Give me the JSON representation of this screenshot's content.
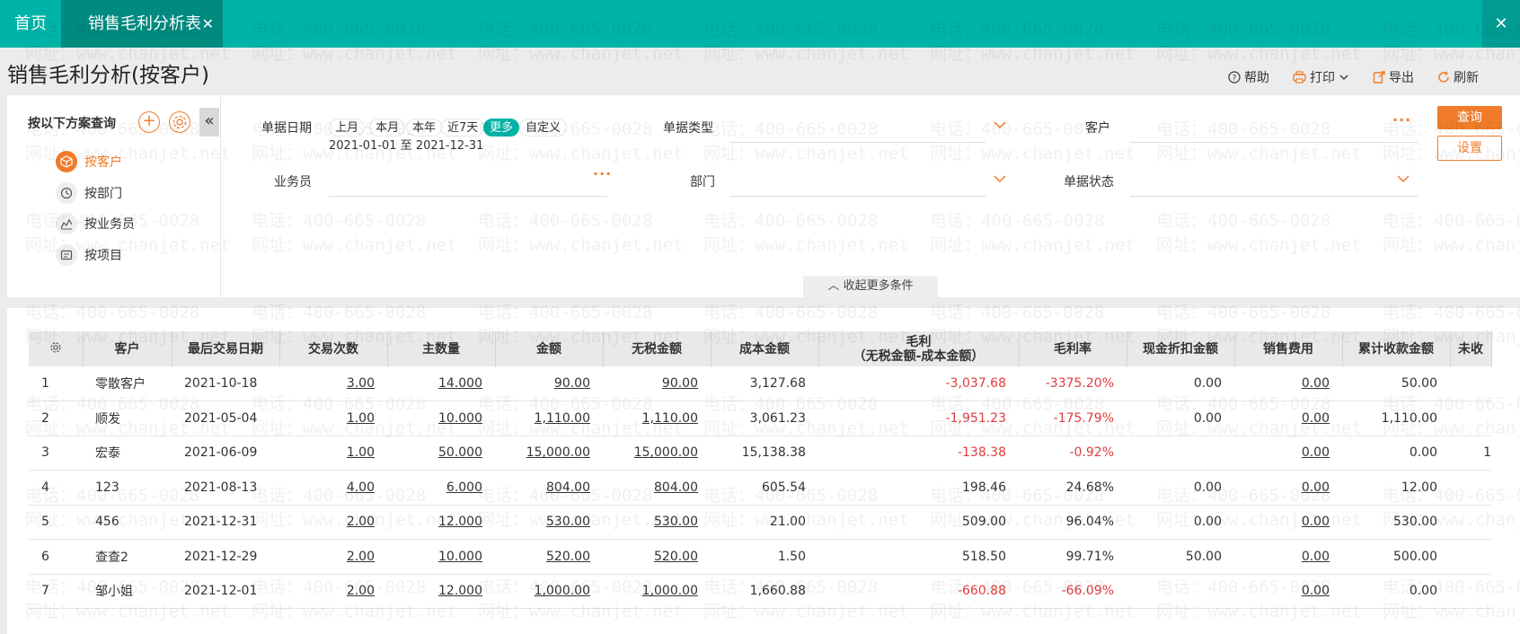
{
  "tabs": {
    "home": "首页",
    "active": "销售毛利分析表"
  },
  "page_title": "销售毛利分析(按客户)",
  "toolbar": {
    "help": "帮助",
    "print": "打印",
    "export": "导出",
    "refresh": "刷新"
  },
  "scheme": {
    "title": "按以下方案查询",
    "items": [
      "按客户",
      "按部门",
      "按业务员",
      "按项目"
    ]
  },
  "filters": {
    "date_label": "单据日期",
    "date_options": [
      "上月",
      "本月",
      "本年",
      "近7天",
      "更多",
      "自定义"
    ],
    "date_range": "2021-01-01 至 2021-12-31",
    "doc_type_label": "单据类型",
    "customer_label": "客户",
    "salesman_label": "业务员",
    "dept_label": "部门",
    "status_label": "单据状态",
    "query_button": "查询",
    "setting_button": "设置",
    "collapse_more": "收起更多条件"
  },
  "table": {
    "headers": [
      "客户",
      "最后交易日期",
      "交易次数",
      "主数量",
      "金额",
      "无税金额",
      "成本金额",
      "毛利",
      "毛利率",
      "现金折扣金额",
      "销售费用",
      "累计收款金额",
      "未收"
    ],
    "gross_profit_sub": "（无税金额-成本金额）",
    "rows": [
      [
        "1",
        "零散客户",
        "2021-10-18",
        "3.00",
        "14.000",
        "90.00",
        "90.00",
        "3,127.68",
        "-3,037.68",
        "-3375.20%",
        "0.00",
        "0.00",
        "50.00",
        ""
      ],
      [
        "2",
        "顺发",
        "2021-05-04",
        "1.00",
        "10.000",
        "1,110.00",
        "1,110.00",
        "3,061.23",
        "-1,951.23",
        "-175.79%",
        "0.00",
        "0.00",
        "1,110.00",
        ""
      ],
      [
        "3",
        "宏泰",
        "2021-06-09",
        "1.00",
        "50.000",
        "15,000.00",
        "15,000.00",
        "15,138.38",
        "-138.38",
        "-0.92%",
        "",
        "0.00",
        "0.00",
        "1"
      ],
      [
        "4",
        "123",
        "2021-08-13",
        "4.00",
        "6.000",
        "804.00",
        "804.00",
        "605.54",
        "198.46",
        "24.68%",
        "0.00",
        "0.00",
        "12.00",
        ""
      ],
      [
        "5",
        "456",
        "2021-12-31",
        "2.00",
        "12.000",
        "530.00",
        "530.00",
        "21.00",
        "509.00",
        "96.04%",
        "0.00",
        "0.00",
        "530.00",
        ""
      ],
      [
        "6",
        "查查2",
        "2021-12-29",
        "2.00",
        "10.000",
        "520.00",
        "520.00",
        "1.50",
        "518.50",
        "99.71%",
        "50.00",
        "0.00",
        "500.00",
        ""
      ],
      [
        "7",
        "邹小姐",
        "2021-12-01",
        "2.00",
        "12.000",
        "1,000.00",
        "1,000.00",
        "1,660.88",
        "-660.88",
        "-66.09%",
        "",
        "0.00",
        "0.00",
        ""
      ]
    ]
  },
  "watermark": {
    "phone": "电话：400-665-0028",
    "site": "网址：www.chanjet.net"
  },
  "colors": {
    "teal": "#00b3a7",
    "teal_dark": "#008a80",
    "orange": "#f07c2a",
    "negative": "#e23b3b"
  }
}
